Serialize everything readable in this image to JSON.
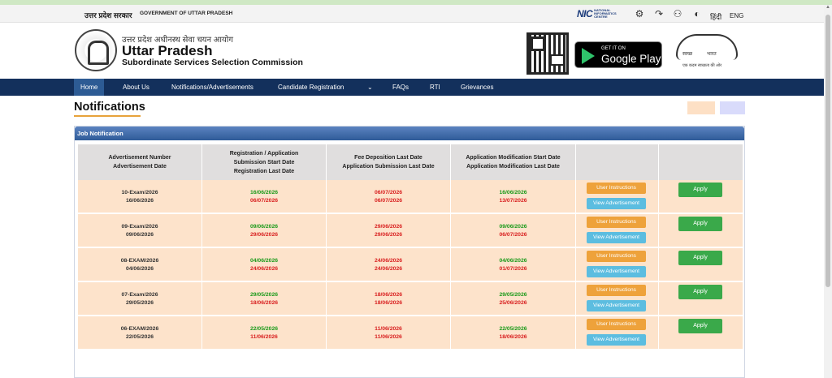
{
  "topbar": {
    "gov_hi": "उत्तर प्रदेश सरकार",
    "gov_en": "GOVERNMENT OF UTTAR PRADESH",
    "nic_logo": "NIC",
    "nic_sub": "NATIONAL INFORMATICS CENTRE",
    "lang_hi": "हिंदी",
    "lang_en": "ENG",
    "icons": [
      "gear-icon",
      "translate-icon",
      "accessibility-people-icon",
      "contrast-icon"
    ]
  },
  "header": {
    "org_hi": "उत्तर प्रदेश अधीनस्थ सेवा चयन आयोग",
    "org_en_line1": "Uttar Pradesh",
    "org_en_line2": "Subordinate Services Selection Commission",
    "gplay_small": "GET IT ON",
    "gplay_big": "Google Play",
    "swachh_left": "स्वच्छ",
    "swachh_right": "भारत",
    "swachh_tagline": "एक कदम स्वच्छता की ओर"
  },
  "nav": {
    "items": [
      "Home",
      "About Us",
      "Notifications/Advertisements",
      "Candidate Registration",
      "⌄",
      "FAQs",
      "RTI",
      "Grievances"
    ],
    "active": "Home"
  },
  "page": {
    "title": "Notifications",
    "legend_colors": [
      "#fde0c5",
      "#d9dbfb"
    ]
  },
  "panel": {
    "title": "Job Notification",
    "columns": [
      [
        "Advertisement Number",
        "Advertisement Date"
      ],
      [
        "Registration / Application",
        "Submission  Start Date",
        "Registration Last Date"
      ],
      [
        "Fee Deposition Last Date",
        "Application  Submission Last Date"
      ],
      [
        "Application Modification  Start Date",
        "Application Modification Last Date"
      ],
      [
        ""
      ],
      [
        ""
      ]
    ],
    "buttons": {
      "instructions": "User Instructions",
      "advertisement": "View Advertisement",
      "apply": "Apply"
    },
    "rows": [
      {
        "adv_no": "10-Exam/2026",
        "adv_date": "16/06/2026",
        "reg_start": "16/06/2026",
        "reg_last": "06/07/2026",
        "fee_last": "06/07/2026",
        "app_last": "06/07/2026",
        "mod_start": "16/06/2026",
        "mod_last": "13/07/2026"
      },
      {
        "adv_no": "09-Exam/2026",
        "adv_date": "09/06/2026",
        "reg_start": "09/06/2026",
        "reg_last": "29/06/2026",
        "fee_last": "29/06/2026",
        "app_last": "29/06/2026",
        "mod_start": "09/06/2026",
        "mod_last": "06/07/2026"
      },
      {
        "adv_no": "08-EXAM/2026",
        "adv_date": "04/06/2026",
        "reg_start": "04/06/2026",
        "reg_last": "24/06/2026",
        "fee_last": "24/06/2026",
        "app_last": "24/06/2026",
        "mod_start": "04/06/2026",
        "mod_last": "01/07/2026"
      },
      {
        "adv_no": "07-Exam/2026",
        "adv_date": "29/05/2026",
        "reg_start": "29/05/2026",
        "reg_last": "18/06/2026",
        "fee_last": "18/06/2026",
        "app_last": "18/06/2026",
        "mod_start": "29/05/2026",
        "mod_last": "25/06/2026"
      },
      {
        "adv_no": "06-EXAM/2026",
        "adv_date": "22/05/2026",
        "reg_start": "22/05/2026",
        "reg_last": "11/06/2026",
        "fee_last": "11/06/2026",
        "app_last": "11/06/2026",
        "mod_start": "22/05/2026",
        "mod_last": "18/06/2026"
      }
    ]
  }
}
